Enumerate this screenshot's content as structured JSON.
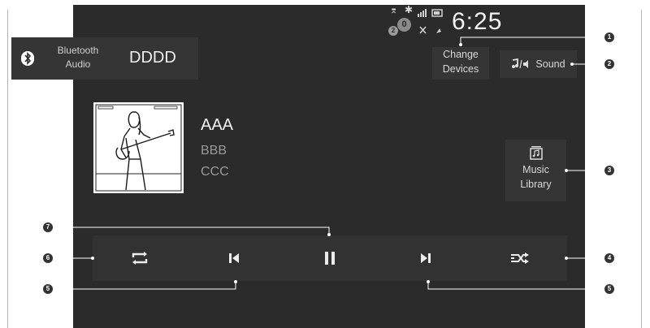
{
  "status_bar": {
    "time": "6:25",
    "notification_count": "0",
    "badge_left": "2"
  },
  "source": {
    "label_line1": "Bluetooth",
    "label_line2": "Audio",
    "device_name": "DDDD",
    "icon": "bluetooth-icon"
  },
  "top_buttons": {
    "change_devices_line1": "Change",
    "change_devices_line2": "Devices",
    "sound_label": "Sound",
    "sound_icon": "music-speaker-icon"
  },
  "track": {
    "title": "AAA",
    "artist": "BBB",
    "album": "CCC"
  },
  "music_library": {
    "line1": "Music",
    "line2": "Library",
    "icon": "library-icon"
  },
  "controls": [
    {
      "name": "repeat",
      "icon": "repeat-icon"
    },
    {
      "name": "previous",
      "icon": "skip-previous-icon"
    },
    {
      "name": "pause",
      "icon": "pause-icon"
    },
    {
      "name": "next",
      "icon": "skip-next-icon"
    },
    {
      "name": "shuffle",
      "icon": "shuffle-icon"
    }
  ],
  "callouts": [
    "1",
    "2",
    "3",
    "4",
    "5",
    "5",
    "6",
    "7"
  ],
  "colors": {
    "screen_bg": "#2b2b2b",
    "button_bg": "#353535",
    "text": "#d8d8d8"
  }
}
